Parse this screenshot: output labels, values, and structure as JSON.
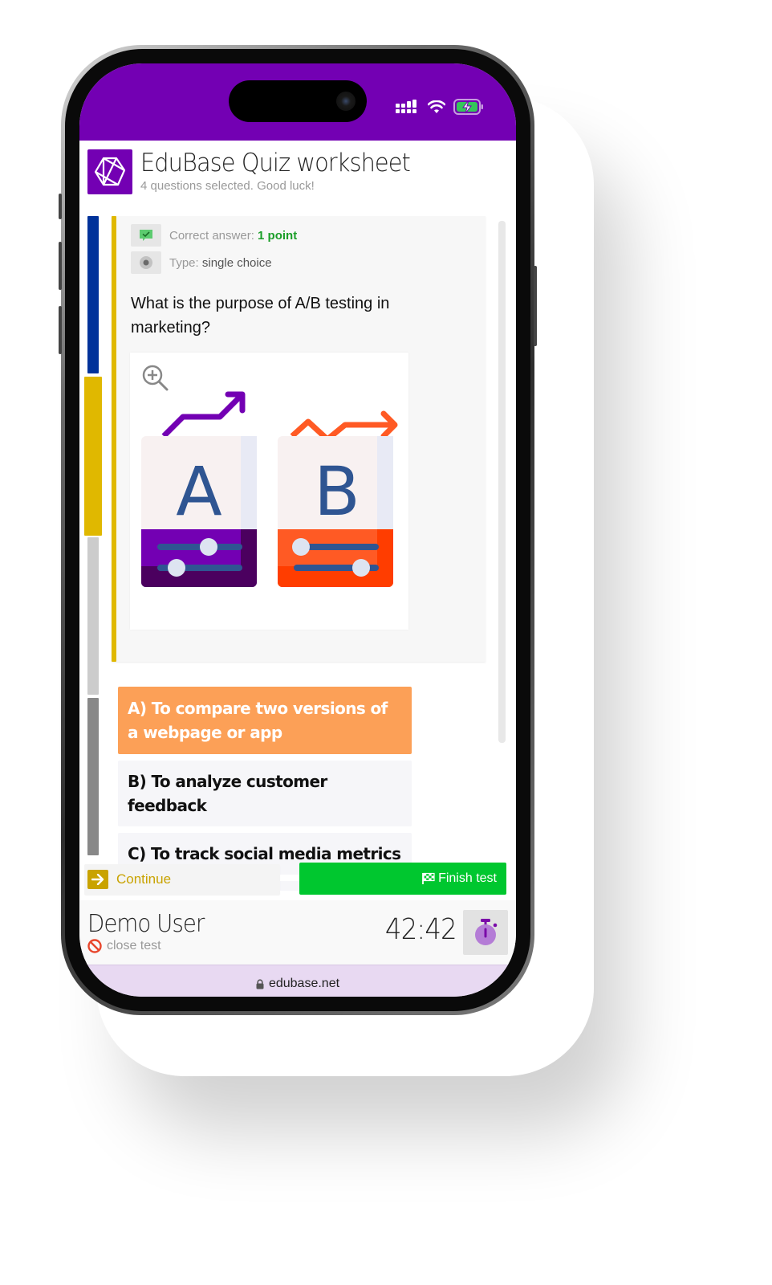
{
  "device": {
    "status_icons": [
      "cellular-signal-icon",
      "wifi-icon",
      "battery-charging-icon"
    ]
  },
  "header": {
    "logo_icon": "edubase-hexagon-logo-icon",
    "title": "EduBase Quiz worksheet",
    "subtitle": "4 questions selected. Good luck!"
  },
  "progress": {
    "segments": [
      {
        "question": 1,
        "color": "#00329a",
        "state": "answered"
      },
      {
        "question": 2,
        "color": "#e0b800",
        "state": "current"
      },
      {
        "question": 3,
        "color": "#cccccc",
        "state": "unanswered"
      },
      {
        "question": 4,
        "color": "#888888",
        "state": "unanswered"
      }
    ]
  },
  "question": {
    "accent_color": "#e0b800",
    "correct_answer_label": "Correct answer:",
    "correct_answer_value": "1 point",
    "type_label": "Type:",
    "type_value": "single choice",
    "text": "What is the purpose of A/B testing in marketing?",
    "image": {
      "zoom_icon": "zoom-in-icon",
      "description": "A/B testing illustration",
      "variants": [
        {
          "letter": "A",
          "color": "#7300b3",
          "trend": "rising"
        },
        {
          "letter": "B",
          "color": "#ff5a24",
          "trend": "zigzag"
        }
      ]
    }
  },
  "answers": [
    {
      "label": "A) To compare two versions of a webpage or app",
      "selected": true
    },
    {
      "label": "B) To analyze customer feedback",
      "selected": false
    },
    {
      "label": "C) To track social media metrics",
      "selected": false
    },
    {
      "label": "",
      "selected": false
    }
  ],
  "actions": {
    "continue_label": "Continue",
    "finish_label": "Finish test",
    "finish_color": "#00c72f"
  },
  "footer": {
    "user_name": "Demo User",
    "close_label": "close test",
    "timer": "42:42"
  },
  "browser": {
    "url": "edubase.net"
  },
  "colors": {
    "brand": "#7300b3",
    "selected_answer": "#fca057",
    "continue": "#c9a300"
  }
}
